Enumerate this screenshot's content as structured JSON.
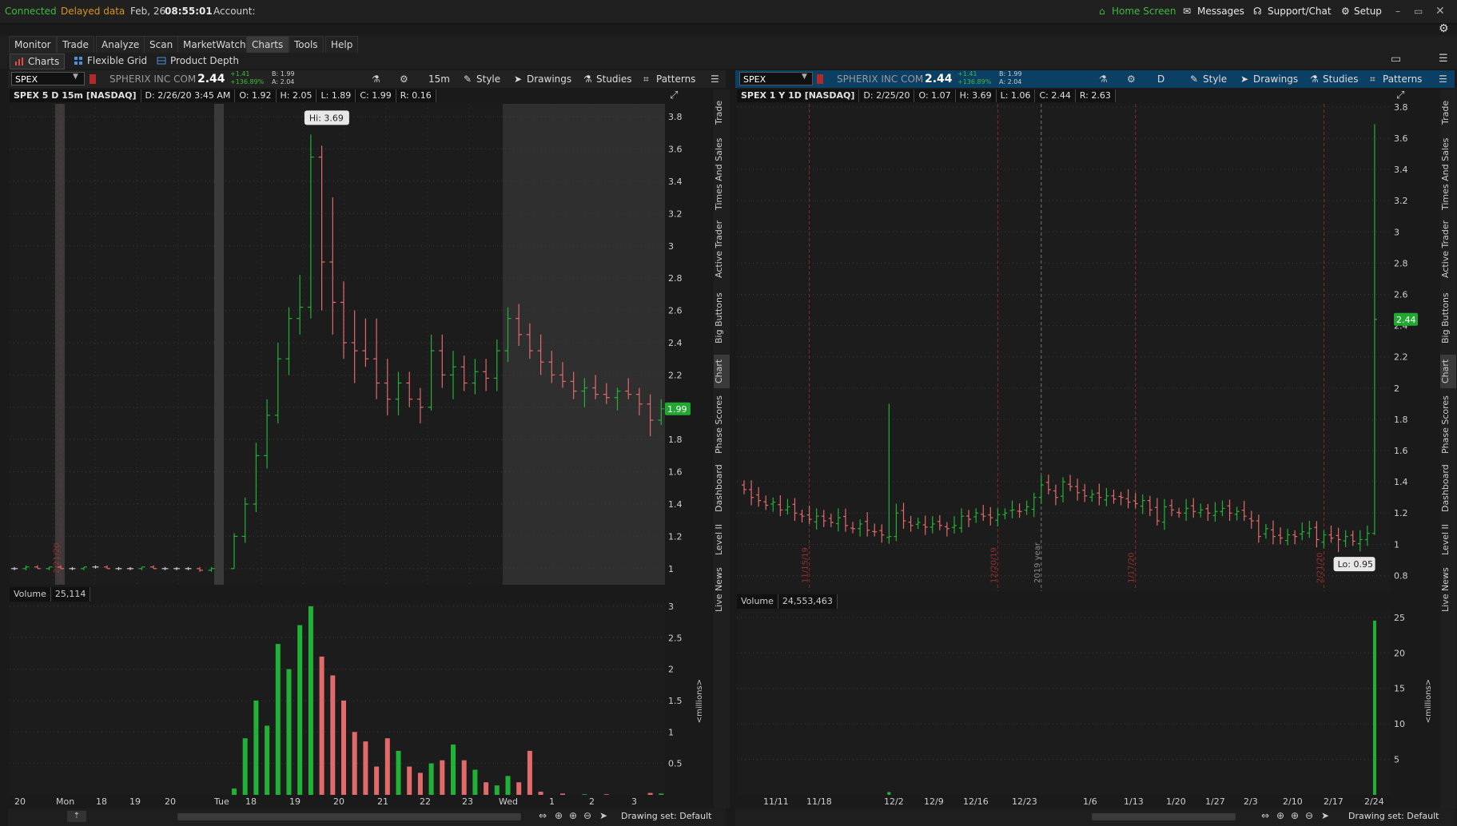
{
  "status": {
    "connected": "Connected",
    "delayed": "Delayed data",
    "date": "Feb, 26",
    "time": "08:55:01",
    "account": "Account:"
  },
  "top_links": {
    "home": "Home Screen",
    "messages": "Messages",
    "support": "Support/Chat",
    "setup": "Setup"
  },
  "colors": {
    "up": "#20b236",
    "down": "#e26a6a",
    "neutral": "#cccccc",
    "accent": "#3dbb3d",
    "orange": "#d8941c"
  },
  "menu": [
    "Monitor",
    "Trade",
    "Analyze",
    "Scan",
    "MarketWatch",
    "Charts",
    "Tools",
    "Help"
  ],
  "subtabs": {
    "charts": "Charts",
    "grid": "Flexible Grid",
    "depth": "Product Depth"
  },
  "left": {
    "symbol": "SPEX",
    "company": "SPHERIX INC COM",
    "last": "2.44",
    "change": "+1.41",
    "change_pct": "+136.89%",
    "bid": "B: 1.99",
    "ask": "A: 2.04",
    "period": "15m",
    "style": "Style",
    "drawings": "Drawings",
    "studies": "Studies",
    "patterns": "Patterns",
    "header": {
      "title": "SPEX 5 D 15m [NASDAQ]",
      "d": "D: 2/26/20 3:45 AM",
      "o": "O: 1.92",
      "h": "H: 2.05",
      "l": "L: 1.89",
      "c": "C: 1.99",
      "r": "R: 0.16"
    },
    "hi_label": "Hi: 3.69",
    "price_badge": "1.99",
    "date_marker": "2/21/20",
    "volume_label": "Volume",
    "volume_value": "25,114",
    "millions": "<millions>",
    "drawing_set": "Drawing set: Default"
  },
  "right": {
    "symbol": "SPEX",
    "company": "SPHERIX INC COM",
    "last": "2.44",
    "change": "+1.41",
    "change_pct": "+136.89%",
    "bid": "B: 1.99",
    "ask": "A: 2.04",
    "period": "D",
    "style": "Style",
    "drawings": "Drawings",
    "studies": "Studies",
    "patterns": "Patterns",
    "header": {
      "title": "SPEX 1 Y 1D [NASDAQ]",
      "d": "D: 2/25/20",
      "o": "O: 1.07",
      "h": "H: 3.69",
      "l": "L: 1.06",
      "c": "C: 2.44",
      "r": "R: 2.63"
    },
    "lo_label": "Lo: 0.95",
    "price_badge": "2.44",
    "markers": [
      "11/15/19",
      "12/20/19",
      "2019 year",
      "1/17/20",
      "2/21/20"
    ],
    "volume_label": "Volume",
    "volume_value": "24,553,463",
    "millions": "<millions>",
    "drawing_set": "Drawing set: Default"
  },
  "side_tabs": [
    "Trade",
    "Times And Sales",
    "Active Trader",
    "Big Buttons",
    "Chart",
    "Phase Scores",
    "Dashboard",
    "Level II",
    "Live News"
  ],
  "chart_data": [
    {
      "type": "candlestick",
      "title": "SPEX 5 D 15m [NASDAQ]",
      "x": [
        "20",
        "Mon",
        "18",
        "19",
        "20",
        "Tue",
        "18",
        "19",
        "20",
        "21",
        "22",
        "23",
        "Wed",
        "1",
        "2",
        "3"
      ],
      "yticks": [
        1,
        1.2,
        1.4,
        1.6,
        1.8,
        2,
        2.2,
        2.4,
        2.6,
        2.8,
        3,
        3.2,
        3.4,
        3.6,
        3.8
      ],
      "ylim": [
        0.9,
        3.88
      ],
      "ohlc": [
        [
          1.0,
          1.01,
          0.99,
          1.0
        ],
        [
          1.0,
          1.02,
          0.99,
          1.01
        ],
        [
          1.01,
          1.02,
          1.0,
          1.0
        ],
        [
          1.0,
          1.01,
          0.99,
          1.01
        ],
        [
          1.01,
          1.02,
          1.0,
          1.0
        ],
        [
          1.0,
          1.01,
          0.99,
          1.0
        ],
        [
          1.0,
          1.01,
          0.99,
          1.01
        ],
        [
          1.01,
          1.02,
          1.0,
          1.01
        ],
        [
          1.01,
          1.02,
          1.0,
          1.0
        ],
        [
          1.0,
          1.01,
          0.99,
          1.0
        ],
        [
          1.0,
          1.01,
          0.99,
          1.0
        ],
        [
          1.0,
          1.01,
          0.99,
          1.01
        ],
        [
          1.01,
          1.02,
          1.0,
          1.0
        ],
        [
          1.0,
          1.01,
          0.99,
          1.0
        ],
        [
          1.0,
          1.01,
          0.99,
          1.0
        ],
        [
          1.0,
          1.01,
          0.99,
          1.0
        ],
        [
          1.0,
          1.01,
          0.98,
          0.99
        ],
        [
          0.99,
          1.01,
          0.98,
          1.0
        ],
        [
          1.0,
          1.22,
          1.0,
          1.2
        ],
        [
          1.2,
          1.44,
          1.16,
          1.4
        ],
        [
          1.4,
          1.78,
          1.35,
          1.7
        ],
        [
          1.7,
          2.05,
          1.62,
          1.95
        ],
        [
          1.95,
          2.4,
          1.9,
          2.3
        ],
        [
          2.3,
          2.62,
          2.2,
          2.55
        ],
        [
          2.55,
          2.82,
          2.45,
          2.62
        ],
        [
          2.62,
          3.69,
          2.55,
          3.55
        ],
        [
          3.55,
          3.62,
          2.6,
          2.9
        ],
        [
          2.9,
          3.3,
          2.45,
          2.65
        ],
        [
          2.65,
          2.78,
          2.3,
          2.4
        ],
        [
          2.4,
          2.6,
          2.15,
          2.35
        ],
        [
          2.35,
          2.55,
          2.25,
          2.3
        ],
        [
          2.3,
          2.55,
          2.05,
          2.15
        ],
        [
          2.15,
          2.3,
          1.95,
          2.05
        ],
        [
          2.05,
          2.22,
          1.95,
          2.15
        ],
        [
          2.15,
          2.22,
          2.0,
          2.05
        ],
        [
          2.05,
          2.12,
          1.9,
          2.0
        ],
        [
          2.0,
          2.45,
          1.98,
          2.35
        ],
        [
          2.35,
          2.45,
          2.12,
          2.2
        ],
        [
          2.2,
          2.35,
          2.05,
          2.25
        ],
        [
          2.25,
          2.32,
          2.1,
          2.15
        ],
        [
          2.15,
          2.3,
          2.08,
          2.22
        ],
        [
          2.22,
          2.3,
          2.1,
          2.18
        ],
        [
          2.18,
          2.42,
          2.1,
          2.35
        ],
        [
          2.35,
          2.62,
          2.28,
          2.55
        ],
        [
          2.55,
          2.64,
          2.38,
          2.45
        ],
        [
          2.45,
          2.52,
          2.3,
          2.35
        ],
        [
          2.35,
          2.45,
          2.2,
          2.28
        ],
        [
          2.28,
          2.35,
          2.15,
          2.2
        ],
        [
          2.2,
          2.28,
          2.12,
          2.16
        ],
        [
          2.16,
          2.22,
          2.05,
          2.1
        ],
        [
          2.1,
          2.18,
          2.0,
          2.12
        ],
        [
          2.12,
          2.2,
          2.05,
          2.08
        ],
        [
          2.08,
          2.15,
          2.02,
          2.06
        ],
        [
          2.06,
          2.12,
          1.98,
          2.1
        ],
        [
          2.1,
          2.18,
          2.05,
          2.08
        ],
        [
          2.08,
          2.12,
          1.95,
          2.02
        ],
        [
          2.02,
          2.08,
          1.82,
          1.92
        ],
        [
          1.92,
          2.05,
          1.89,
          1.99
        ]
      ],
      "volume": [
        0,
        0,
        0,
        0,
        0,
        0,
        0,
        0,
        0,
        0,
        0,
        0,
        0,
        0,
        0,
        0,
        0,
        0,
        0.1,
        0.9,
        1.5,
        1.1,
        2.4,
        2.0,
        2.7,
        3.0,
        2.2,
        1.9,
        1.5,
        1.0,
        0.85,
        0.45,
        0.9,
        0.7,
        0.45,
        0.35,
        0.5,
        0.55,
        0.8,
        0.55,
        0.4,
        0.2,
        0.15,
        0.3,
        0.2,
        0.7,
        0.05,
        0.0,
        0.02,
        0.0,
        0.01,
        0.0,
        0.01,
        0.0,
        0.0,
        0.0,
        0.03,
        0.02
      ],
      "volume_yticks": [
        0.5,
        1,
        1.5,
        2,
        2.5,
        3
      ],
      "volume_ylim": [
        0,
        3.05
      ]
    },
    {
      "type": "candlestick",
      "title": "SPEX 1 Y 1D [NASDAQ]",
      "x": [
        "11/11",
        "11/18",
        "12/2",
        "12/9",
        "12/16",
        "12/23",
        "1/6",
        "1/13",
        "1/20",
        "1/27",
        "2/3",
        "2/10",
        "2/17",
        "2/24"
      ],
      "yticks": [
        0.8,
        1,
        1.2,
        1.4,
        1.6,
        1.8,
        2,
        2.2,
        2.4,
        2.6,
        2.8,
        3,
        3.2,
        3.4,
        3.6,
        3.8
      ],
      "ylim": [
        0.7,
        3.82
      ],
      "closes": [
        1.35,
        1.3,
        1.28,
        1.25,
        1.27,
        1.22,
        1.24,
        1.2,
        1.18,
        1.16,
        1.18,
        1.15,
        1.14,
        1.17,
        1.12,
        1.1,
        1.13,
        1.09,
        1.08,
        1.06,
        1.05,
        1.2,
        1.15,
        1.12,
        1.14,
        1.11,
        1.13,
        1.12,
        1.1,
        1.12,
        1.18,
        1.16,
        1.2,
        1.18,
        1.17,
        1.19,
        1.2,
        1.22,
        1.21,
        1.24,
        1.3,
        1.38,
        1.35,
        1.3,
        1.4,
        1.37,
        1.33,
        1.31,
        1.32,
        1.3,
        1.31,
        1.29,
        1.3,
        1.27,
        1.26,
        1.28,
        1.22,
        1.15,
        1.24,
        1.22,
        1.2,
        1.23,
        1.21,
        1.22,
        1.2,
        1.21,
        1.23,
        1.2,
        1.21,
        1.18,
        1.15,
        1.05,
        1.1,
        1.05,
        1.04,
        1.06,
        1.05,
        1.08,
        1.1,
        1.03,
        1.06,
        1.04,
        1.03,
        1.05,
        1.02,
        1.03,
        1.07,
        2.44
      ],
      "volume": [
        0,
        0,
        0,
        0,
        0,
        0,
        0,
        0,
        0,
        0,
        0,
        0,
        0,
        0,
        0,
        0,
        0,
        0,
        0,
        0,
        0.4,
        0,
        0,
        0,
        0,
        0,
        0,
        0,
        0,
        0,
        0,
        0,
        0,
        0,
        0,
        0,
        0,
        0,
        0,
        0,
        0,
        0,
        0,
        0,
        0,
        0,
        0,
        0,
        0,
        0,
        0,
        0,
        0,
        0,
        0,
        0,
        0,
        0,
        0,
        0,
        0,
        0,
        0,
        0,
        0,
        0,
        0,
        0,
        0,
        0,
        0,
        0,
        0,
        0,
        0,
        0,
        0,
        0,
        0,
        0,
        0,
        0,
        0,
        0,
        0,
        0,
        0,
        24.55
      ],
      "volume_yticks": [
        5,
        10,
        15,
        20,
        25
      ],
      "volume_ylim": [
        0,
        26
      ]
    }
  ]
}
